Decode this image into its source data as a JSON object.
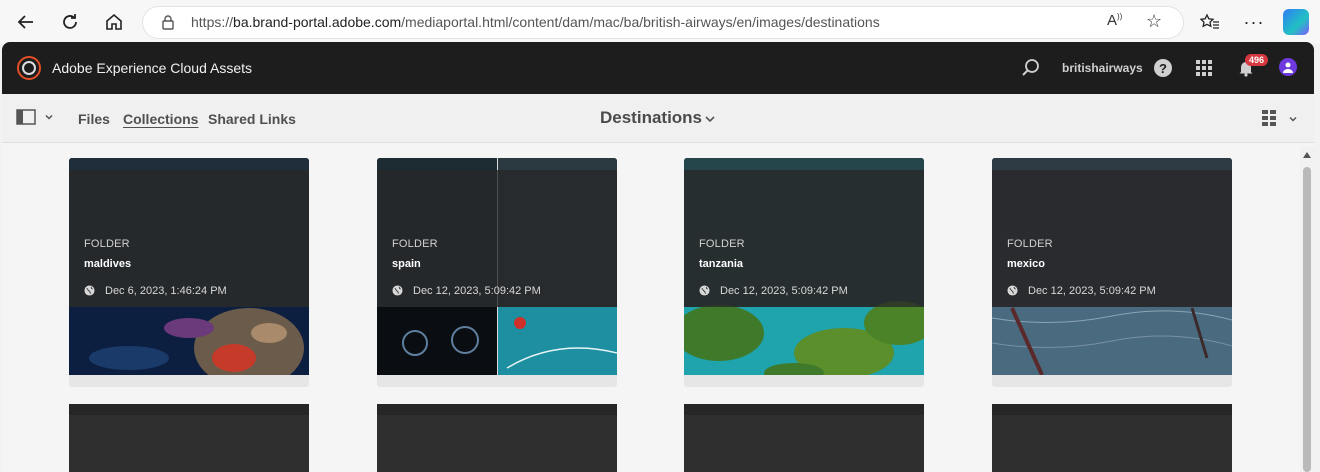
{
  "browser": {
    "url_prefix": "https://",
    "url_host": "ba.brand-portal.adobe.com",
    "url_path": "/mediaportal.html/content/dam/mac/ba/british-airways/en/images/destinations"
  },
  "shell": {
    "app_title": "Adobe Experience Cloud Assets",
    "org_name": "britishairways",
    "notification_count": "496"
  },
  "actionbar": {
    "nav": [
      "Files",
      "Collections",
      "Shared Links"
    ],
    "active_nav": "Collections",
    "page_title": "Destinations"
  },
  "cards": [
    {
      "type": "FOLDER",
      "name": "maldives",
      "date": "Dec 6, 2023, 1:46:24 PM"
    },
    {
      "type": "FOLDER",
      "name": "spain",
      "date": "Dec 12, 2023, 5:09:42 PM"
    },
    {
      "type": "FOLDER",
      "name": "tanzania",
      "date": "Dec 12, 2023, 5:09:42 PM"
    },
    {
      "type": "FOLDER",
      "name": "mexico",
      "date": "Dec 12, 2023, 5:09:42 PM"
    }
  ],
  "icons": {
    "back": "arrow-left-icon",
    "refresh": "refresh-icon",
    "home": "home-icon",
    "lock": "lock-icon",
    "read_aloud": "read-aloud-icon",
    "favorite": "star-icon",
    "favorites_bar": "favorites-icon",
    "more": "more-icon",
    "search": "search-icon",
    "help": "help-icon",
    "apps": "apps-grid-icon",
    "bell": "bell-icon",
    "rail": "rail-toggle-icon",
    "view": "grid-view-icon"
  },
  "colors": {
    "shell_bg": "#1d1d1d",
    "accent_orange": "#e34f26",
    "badge_red": "#d7373f",
    "avatar_purple": "#6e3ae0"
  }
}
